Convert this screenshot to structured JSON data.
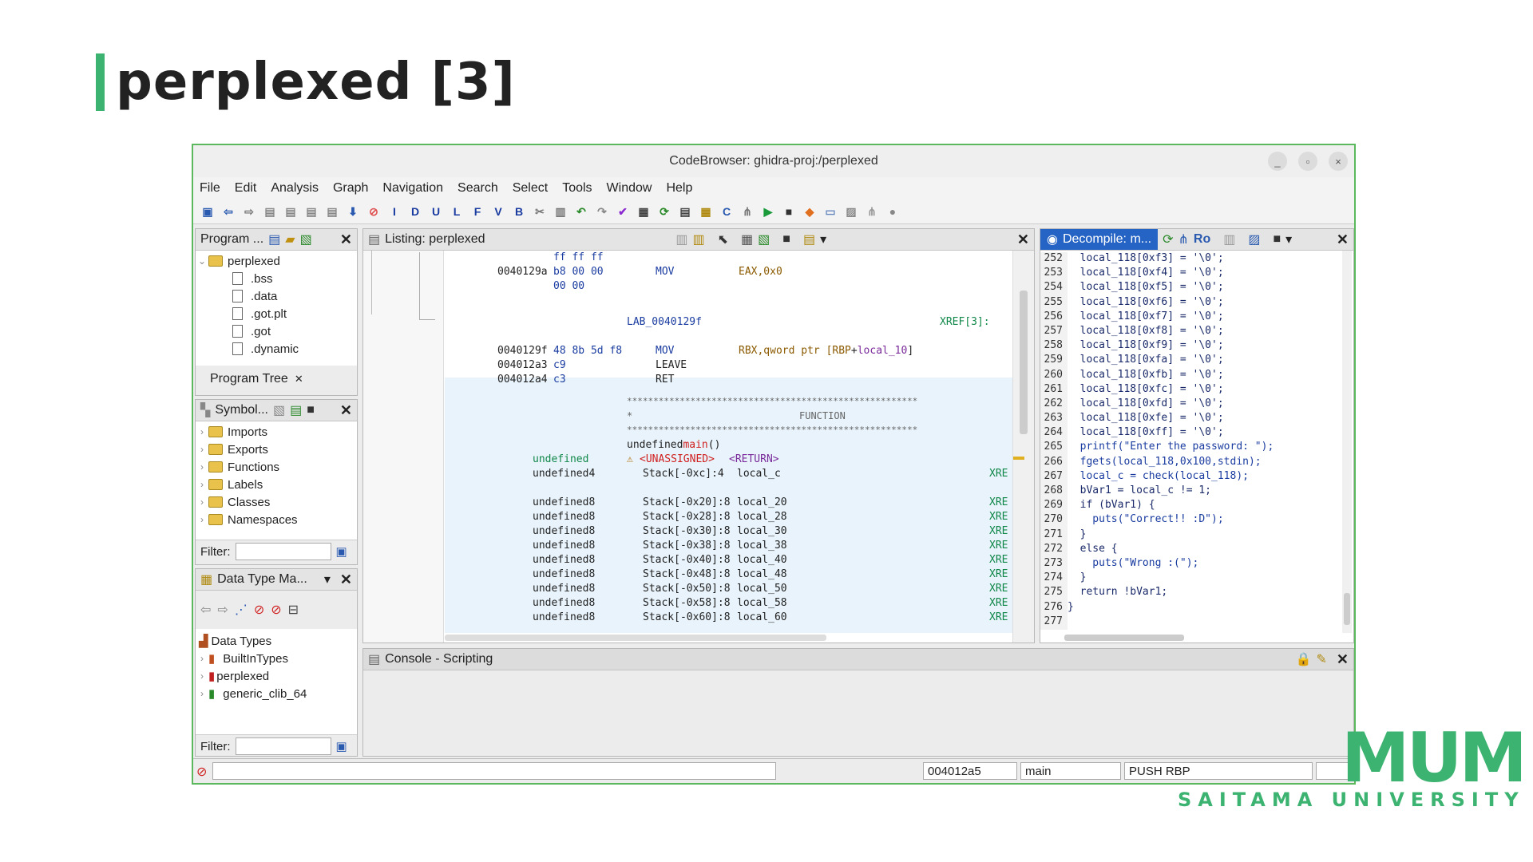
{
  "slide": {
    "title": "perplexed [3]"
  },
  "window": {
    "title": "CodeBrowser: ghidra-proj:/perplexed",
    "controls": [
      "_",
      "▫",
      "×"
    ]
  },
  "menu": [
    "File",
    "Edit",
    "Analysis",
    "Graph",
    "Navigation",
    "Search",
    "Select",
    "Tools",
    "Window",
    "Help"
  ],
  "toolbar_letters": [
    "I",
    "D",
    "U",
    "L",
    "F",
    "V",
    "B"
  ],
  "program_trees": {
    "title": "Program ...",
    "root": "perplexed",
    "items": [
      ".bss",
      ".data",
      ".got.plt",
      ".got",
      ".dynamic"
    ],
    "tab": "Program Tree"
  },
  "symbol_tree": {
    "title": "Symbol...",
    "items": [
      "Imports",
      "Exports",
      "Functions",
      "Labels",
      "Classes",
      "Namespaces"
    ],
    "filter_label": "Filter:"
  },
  "data_types": {
    "title": "Data Type Ma...",
    "root": "Data Types",
    "items": [
      "BuiltInTypes",
      "perplexed",
      "generic_clib_64"
    ],
    "filter_label": "Filter:"
  },
  "listing": {
    "title": "Listing:  perplexed",
    "top": [
      {
        "addr": "",
        "bytes": "ff ff ff",
        "mnem": "",
        "op": ""
      },
      {
        "addr": "0040129a",
        "bytes": "b8 00 00",
        "mnem": "MOV",
        "op": "EAX,0x0"
      },
      {
        "addr": "",
        "bytes": "00 00",
        "mnem": "",
        "op": ""
      }
    ],
    "label": "LAB_0040129f",
    "xref": "XREF[3]:",
    "mid": [
      {
        "addr": "0040129f",
        "bytes": "48 8b 5d f8",
        "mnem": "MOV",
        "op_a": "RBX,qword ptr [",
        "op_b": "RBP",
        "op_c": " + ",
        "op_d": "local_10",
        "op_e": "]"
      },
      {
        "addr": "004012a3",
        "bytes": "c9",
        "mnem": "LEAVE",
        "op_a": "",
        "op_b": "",
        "op_c": "",
        "op_d": "",
        "op_e": ""
      },
      {
        "addr": "004012a4",
        "bytes": "c3",
        "mnem": "RET",
        "op_a": "",
        "op_b": "",
        "op_c": "",
        "op_d": "",
        "op_e": ""
      }
    ],
    "stars": "*******************************************************",
    "func_star": "*",
    "func_word": "FUNCTION",
    "signature_a": "undefined ",
    "signature_b": "main",
    "signature_c": "()",
    "ret_type": "undefined",
    "unassigned": "<UNASSIGNED>",
    "ret": "<RETURN>",
    "params": [
      {
        "type": "undefined4",
        "loc": "Stack[-0xc]:4",
        "name": "local_c",
        "x": "XRE"
      },
      {
        "type": "",
        "loc": "",
        "name": "",
        "x": ""
      },
      {
        "type": "undefined8",
        "loc": "Stack[-0x20]:8",
        "name": "local_20",
        "x": "XRE"
      },
      {
        "type": "undefined8",
        "loc": "Stack[-0x28]:8",
        "name": "local_28",
        "x": "XRE"
      },
      {
        "type": "undefined8",
        "loc": "Stack[-0x30]:8",
        "name": "local_30",
        "x": "XRE"
      },
      {
        "type": "undefined8",
        "loc": "Stack[-0x38]:8",
        "name": "local_38",
        "x": "XRE"
      },
      {
        "type": "undefined8",
        "loc": "Stack[-0x40]:8",
        "name": "local_40",
        "x": "XRE"
      },
      {
        "type": "undefined8",
        "loc": "Stack[-0x48]:8",
        "name": "local_48",
        "x": "XRE"
      },
      {
        "type": "undefined8",
        "loc": "Stack[-0x50]:8",
        "name": "local_50",
        "x": "XRE"
      },
      {
        "type": "undefined8",
        "loc": "Stack[-0x58]:8",
        "name": "local_58",
        "x": "XRE"
      },
      {
        "type": "undefined8",
        "loc": "Stack[-0x60]:8",
        "name": "local_60",
        "x": "XRE"
      }
    ]
  },
  "decompile": {
    "title": "Decompile: m...",
    "ro": "Ro",
    "lines": [
      {
        "n": "252",
        "code": "  local_118[0xf3] = '\\0';"
      },
      {
        "n": "253",
        "code": "  local_118[0xf4] = '\\0';"
      },
      {
        "n": "254",
        "code": "  local_118[0xf5] = '\\0';"
      },
      {
        "n": "255",
        "code": "  local_118[0xf6] = '\\0';"
      },
      {
        "n": "256",
        "code": "  local_118[0xf7] = '\\0';"
      },
      {
        "n": "257",
        "code": "  local_118[0xf8] = '\\0';"
      },
      {
        "n": "258",
        "code": "  local_118[0xf9] = '\\0';"
      },
      {
        "n": "259",
        "code": "  local_118[0xfa] = '\\0';"
      },
      {
        "n": "260",
        "code": "  local_118[0xfb] = '\\0';"
      },
      {
        "n": "261",
        "code": "  local_118[0xfc] = '\\0';"
      },
      {
        "n": "262",
        "code": "  local_118[0xfd] = '\\0';"
      },
      {
        "n": "263",
        "code": "  local_118[0xfe] = '\\0';"
      },
      {
        "n": "264",
        "code": "  local_118[0xff] = '\\0';"
      },
      {
        "n": "265",
        "code": "  printf(\"Enter the password: \");"
      },
      {
        "n": "266",
        "code": "  fgets(local_118,0x100,stdin);"
      },
      {
        "n": "267",
        "code": "  local_c = check(local_118);"
      },
      {
        "n": "268",
        "code": "  bVar1 = local_c != 1;"
      },
      {
        "n": "269",
        "code": "  if (bVar1) {"
      },
      {
        "n": "270",
        "code": "    puts(\"Correct!! :D\");"
      },
      {
        "n": "271",
        "code": "  }"
      },
      {
        "n": "272",
        "code": "  else {"
      },
      {
        "n": "273",
        "code": "    puts(\"Wrong :(\");"
      },
      {
        "n": "274",
        "code": "  }"
      },
      {
        "n": "275",
        "code": "  return !bVar1;"
      },
      {
        "n": "276",
        "code": "}"
      },
      {
        "n": "277",
        "code": ""
      }
    ]
  },
  "console": {
    "title": "Console - Scripting"
  },
  "status": {
    "address": "004012a5",
    "function": "main",
    "instruction": "PUSH RBP"
  },
  "logo": {
    "mark": "MUM",
    "text": "SAITAMA UNIVERSITY"
  },
  "colors": {
    "accent": "#3cb371",
    "selection": "#e8f3fb",
    "active_tab": "#2563c4"
  }
}
